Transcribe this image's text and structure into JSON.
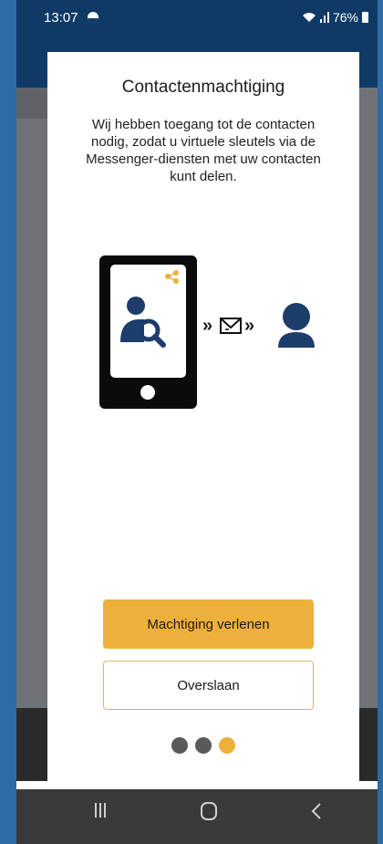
{
  "status_bar": {
    "time": "13:07",
    "battery": "76%"
  },
  "dialog": {
    "title": "Contactenmachtiging",
    "description": "Wij hebben toegang tot de contacten nodig, zodat u virtuele sleutels via de Messenger-diensten met uw contacten kunt delen.",
    "illustration": {
      "arrows": "»",
      "icons": [
        "phone-icon",
        "share-icon",
        "contact-search-icon",
        "envelope-icon",
        "person-icon"
      ]
    },
    "grant_button_label": "Machtiging verlenen",
    "skip_button_label": "Overslaan",
    "pager": {
      "total": 3,
      "active_index": 2,
      "inactive_color": "#5a5a5a",
      "active_color": "#eeb03c"
    }
  },
  "navigation_bar": {
    "icons": [
      "recent-apps-icon",
      "home-icon",
      "back-icon"
    ]
  },
  "colors": {
    "accent": "#eeb03c",
    "header": "#103a66",
    "illustration_blue": "#1d3d6b"
  }
}
